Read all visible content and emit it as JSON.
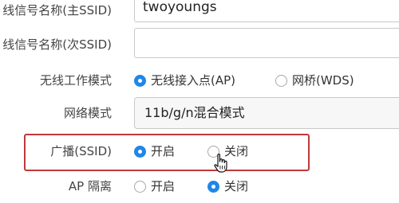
{
  "fields": {
    "primary_ssid": {
      "label": "线信号名称(主SSID)",
      "value": "twoyoungs"
    },
    "secondary_ssid": {
      "label": "线信号名称(次SSID)",
      "value": ""
    },
    "wireless_mode": {
      "label": "无线工作模式",
      "options": [
        {
          "label": "无线接入点(AP)",
          "checked": true
        },
        {
          "label": "网桥(WDS)",
          "checked": false
        }
      ]
    },
    "network_mode": {
      "label": "网络模式",
      "value": "11b/g/n混合模式"
    },
    "broadcast_ssid": {
      "label": "广播(SSID)",
      "options": [
        {
          "label": "开启",
          "checked": true
        },
        {
          "label": "关闭",
          "checked": false
        }
      ]
    },
    "ap_isolation": {
      "label": "AP 隔离",
      "options": [
        {
          "label": "开启",
          "checked": false
        },
        {
          "label": "关闭",
          "checked": true
        }
      ]
    }
  },
  "colors": {
    "accent": "#1f87e8",
    "highlight_border": "#c0393b"
  },
  "icons": {
    "cursor": "hand-pointer-icon"
  }
}
